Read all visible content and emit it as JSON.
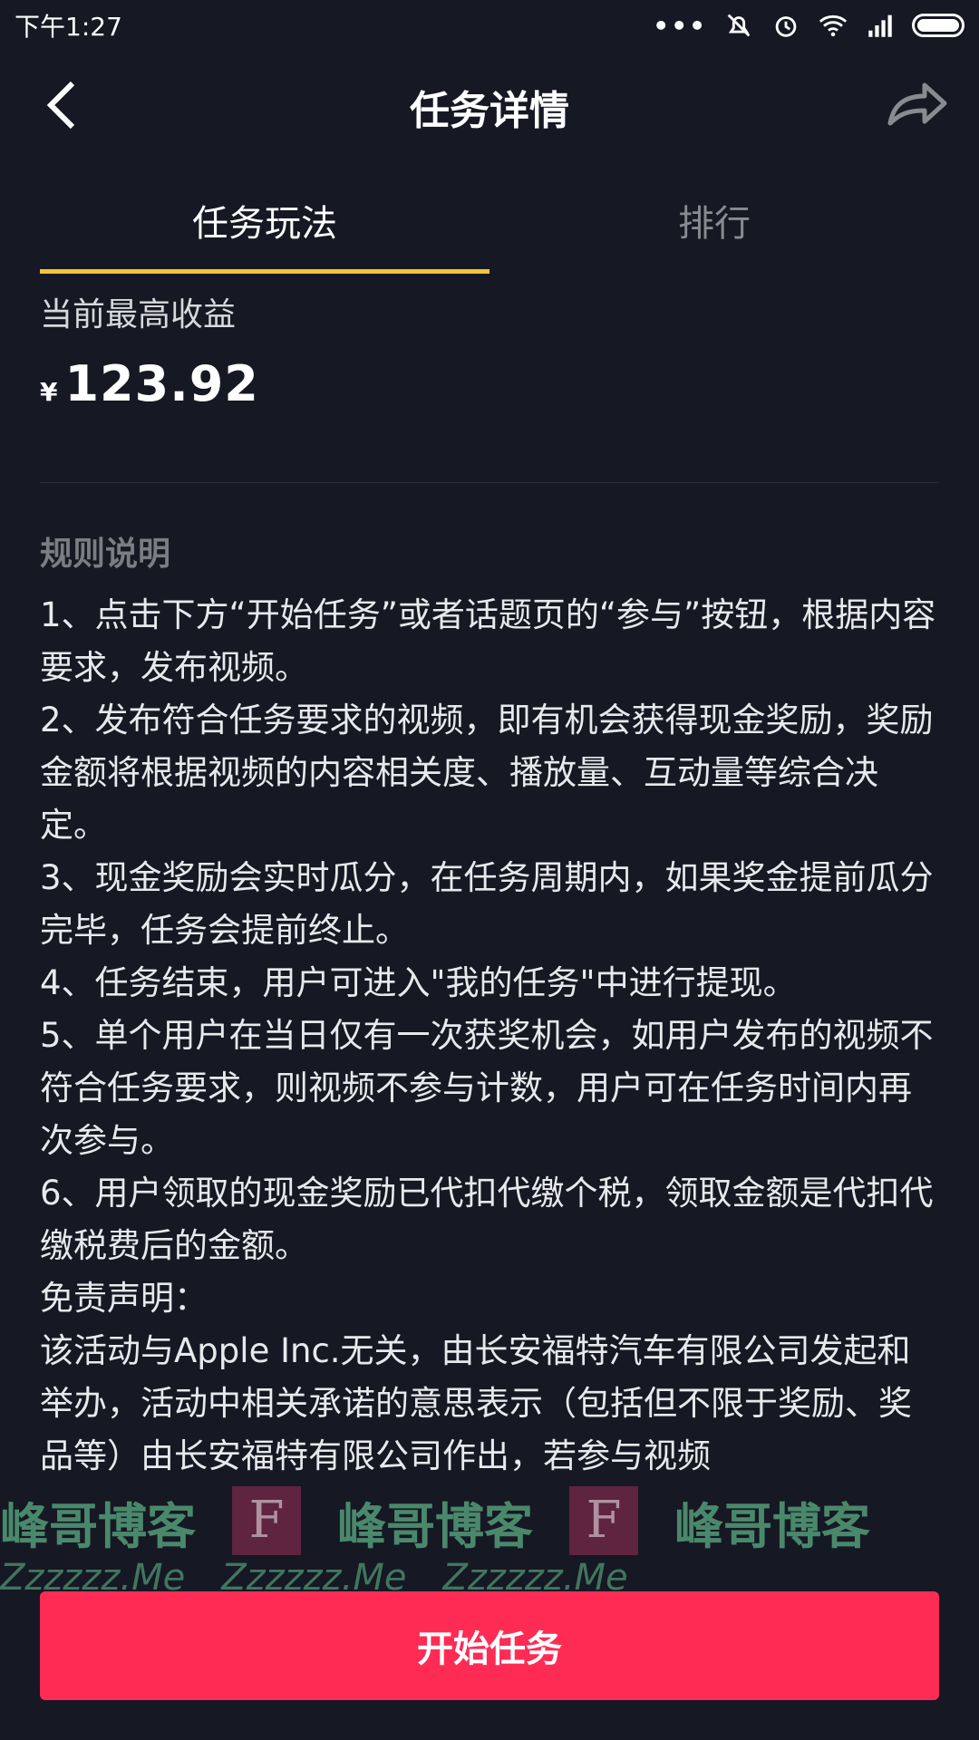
{
  "status_bar": {
    "time": "下午1:27",
    "dots": "•••"
  },
  "header": {
    "title": "任务详情"
  },
  "tabs": [
    {
      "label": "任务玩法",
      "active": true
    },
    {
      "label": "排行",
      "active": false
    }
  ],
  "earnings": {
    "label": "当前最高收益",
    "currency": "¥",
    "amount": "123.92"
  },
  "rules": {
    "heading": "规则说明",
    "lines": [
      "1、点击下方“开始任务”或者话题页的“参与”按钮，根据内容要求，发布视频。",
      "2、发布符合任务要求的视频，即有机会获得现金奖励，奖励金额将根据视频的内容相关度、播放量、互动量等综合决定。",
      "3、现金奖励会实时瓜分，在任务周期内，如果奖金提前瓜分完毕，任务会提前终止。",
      "4、任务结束，用户可进入\"我的任务\"中进行提现。",
      "5、单个用户在当日仅有一次获奖机会，如用户发布的视频不符合任务要求，则视频不参与计数，用户可在任务时间内再次参与。",
      "6、用户领取的现金奖励已代扣代缴个税，领取金额是代扣代缴税费后的金额。",
      "免责声明：",
      "该活动与Apple Inc.无关，由长安福特汽车有限公司发起和举办，活动中相关承诺的意思表示（包括但不限于奖励、奖品等）由长安福特有限公司作出，若参与视频"
    ]
  },
  "watermark": {
    "title": "峰哥博客",
    "sub": "Zzzzzz.Me",
    "f": "F"
  },
  "action": {
    "start_label": "开始任务"
  }
}
